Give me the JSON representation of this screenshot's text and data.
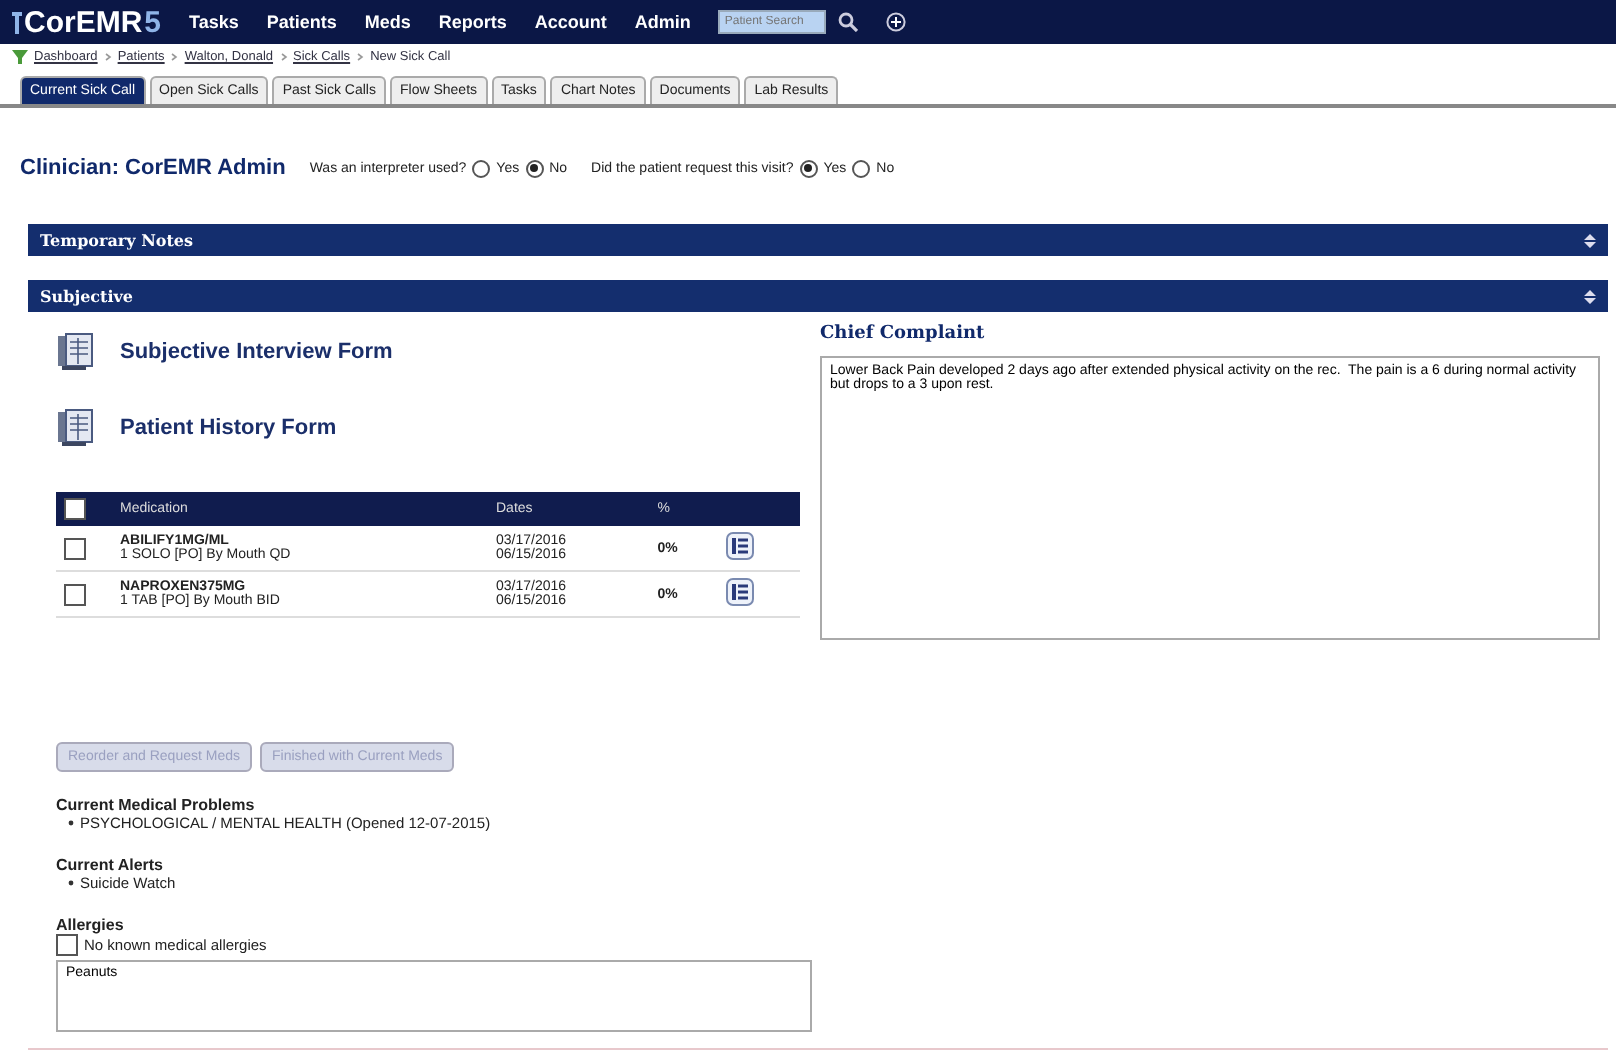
{
  "app": {
    "logo": "CorEMR5",
    "menu": [
      "Tasks",
      "Patients",
      "Meds",
      "Reports",
      "Account",
      "Admin"
    ],
    "search": {
      "placeholder": "Patient Search"
    }
  },
  "breadcrumb": [
    "Dashboard",
    "Patients",
    "Walton, Donald",
    "Sick Calls",
    "New Sick Call"
  ],
  "tabs": [
    {
      "label": "Current Sick Call",
      "selected": true
    },
    {
      "label": "Open Sick Calls",
      "selected": false
    },
    {
      "label": "Past Sick Calls",
      "selected": false
    },
    {
      "label": "Flow Sheets",
      "selected": false
    },
    {
      "label": "Tasks",
      "selected": false
    },
    {
      "label": "Chart Notes",
      "selected": false
    },
    {
      "label": "Documents",
      "selected": false
    },
    {
      "label": "Lab Results",
      "selected": false
    }
  ],
  "clinician": "Clinician: CorEMR Admin",
  "questions": [
    {
      "label": "Was an interpreter used?",
      "options": [
        {
          "label": "Yes",
          "selected": false
        },
        {
          "label": "No",
          "selected": true
        }
      ]
    },
    {
      "label": "Did the patient request this visit?",
      "options": [
        {
          "label": "Yes",
          "selected": true
        },
        {
          "label": "No",
          "selected": false
        }
      ]
    }
  ],
  "sections": [
    {
      "title": "Temporary Notes"
    },
    {
      "title": "Subjective"
    }
  ],
  "forms": [
    "Subjective Interview Form",
    "Patient History Form"
  ],
  "medications": {
    "columns": [
      "Medication",
      "Dates",
      "%"
    ],
    "all_checked": false,
    "rows": [
      {
        "checked": false,
        "name": "ABILIFY1MG/ML",
        "sig": "1 SOLO [PO] By Mouth QD",
        "start": "03/17/2016",
        "end": "06/15/2016",
        "percent": "0%"
      },
      {
        "checked": false,
        "name": "NAPROXEN375MG",
        "sig": "1 TAB [PO] By Mouth BID",
        "start": "03/17/2016",
        "end": "06/15/2016",
        "percent": "0%"
      }
    ]
  },
  "buttons": [
    {
      "label": "Reorder and Request Meds",
      "disabled": true
    },
    {
      "label": "Finished with Current Meds",
      "disabled": true
    }
  ],
  "lists": [
    {
      "title": "Current Medical Problems",
      "items": [
        "PSYCHOLOGICAL / MENTAL HEALTH (Opened 12-07-2015)"
      ]
    },
    {
      "title": "Current Alerts",
      "items": [
        "Suicide Watch"
      ]
    }
  ],
  "allergies": {
    "title": "Allergies",
    "no_known": {
      "label": "No known medical allergies",
      "checked": false
    },
    "value": "Peanuts"
  },
  "chief_complaint": {
    "title": "Chief Complaint",
    "value": "Lower Back Pain developed 2 days ago after extended physical activity on the rec.  The pain is a 6 during normal activity but drops to a 3 upon rest."
  }
}
